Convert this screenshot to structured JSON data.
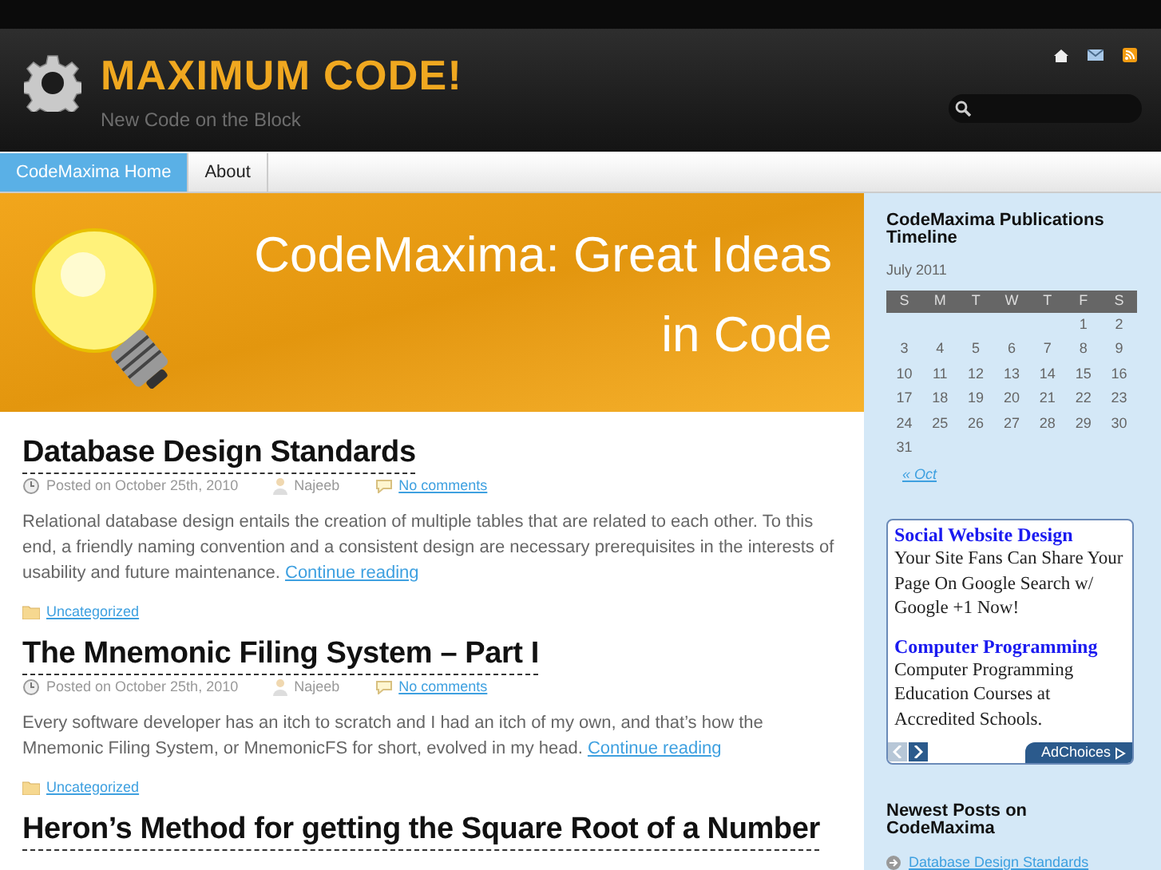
{
  "site": {
    "title": "MAXIMUM CODE!",
    "tagline": "New Code on the Block"
  },
  "nav": [
    {
      "label": "CodeMaxima Home",
      "selected": true
    },
    {
      "label": "About",
      "selected": false
    }
  ],
  "banner": {
    "text": "CodeMaxima: Great Ideas in Code"
  },
  "posts": [
    {
      "title": "Database Design Standards",
      "date": "Posted on October 25th, 2010",
      "author": "Najeeb",
      "comments": "No comments",
      "excerpt": "Relational database design entails the creation of multiple tables that are related to each other. To this end, a friendly naming convention and a consistent design are necessary prerequisites in the interests of usability and future maintenance.",
      "more": "Continue reading",
      "category": "Uncategorized"
    },
    {
      "title": "The Mnemonic Filing System – Part I",
      "date": "Posted on October 25th, 2010",
      "author": "Najeeb",
      "comments": "No comments",
      "excerpt": "Every software developer has an itch to scratch and I had an itch of my own, and that’s how the Mnemonic Filing System, or MnemonicFS for short, evolved in my head.",
      "more": "Continue reading",
      "category": "Uncategorized"
    },
    {
      "title": "Heron’s Method for getting the Square Root of a Number"
    }
  ],
  "sidebar": {
    "calendar": {
      "heading": "CodeMaxima Publications Timeline",
      "month": "July 2011",
      "weekdays": [
        "S",
        "M",
        "T",
        "W",
        "T",
        "F",
        "S"
      ],
      "weeks": [
        [
          "1",
          "2"
        ],
        [
          "3",
          "4",
          "5",
          "6",
          "7",
          "8",
          "9"
        ],
        [
          "10",
          "11",
          "12",
          "13",
          "14",
          "15",
          "16"
        ],
        [
          "17",
          "18",
          "19",
          "20",
          "21",
          "22",
          "23"
        ],
        [
          "24",
          "25",
          "26",
          "27",
          "28",
          "29",
          "30"
        ],
        [
          "31"
        ]
      ],
      "prev": "« Oct"
    },
    "ad": {
      "items": [
        {
          "title": "Social Website Design",
          "text": "Your Site Fans Can Share Your Page On Google Search w/ Google +1 Now!"
        },
        {
          "title": "Computer Programming",
          "text": "Computer Programming Education Courses at Accredited Schools."
        }
      ],
      "badge": "AdChoices"
    },
    "newest": {
      "heading": "Newest Posts on CodeMaxima",
      "items": [
        "Database Design Standards"
      ]
    }
  }
}
